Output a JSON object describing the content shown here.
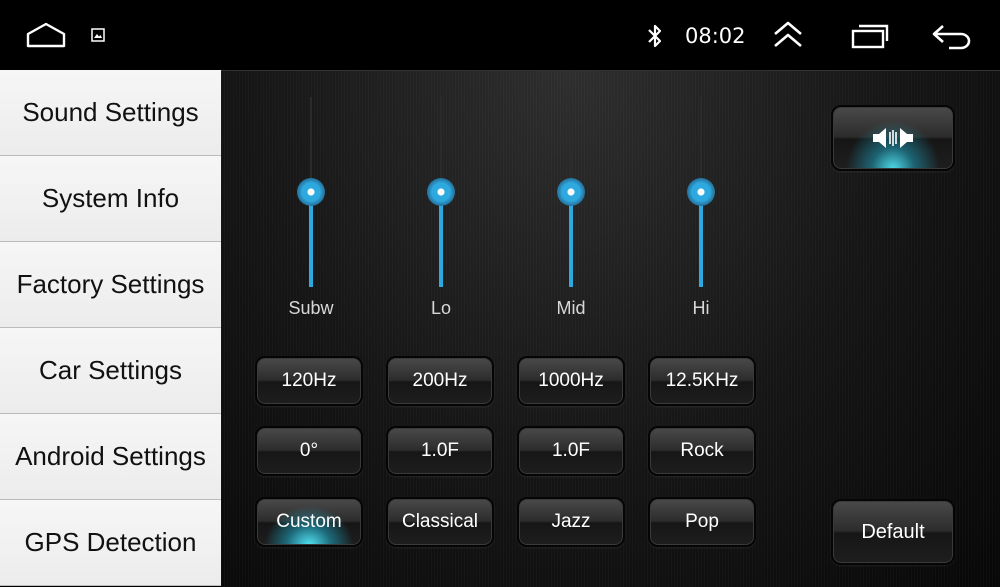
{
  "status_bar": {
    "time": "08:02",
    "icons": [
      "home-icon",
      "gallery-icon",
      "bluetooth-icon",
      "expand-up-icon",
      "recent-apps-icon",
      "back-icon"
    ]
  },
  "sidebar": {
    "items": [
      {
        "label": "Sound Settings"
      },
      {
        "label": "System Info"
      },
      {
        "label": "Factory Settings"
      },
      {
        "label": "Car Settings"
      },
      {
        "label": "Android Settings"
      },
      {
        "label": "GPS Detection"
      }
    ]
  },
  "equalizer": {
    "accent_color": "#2ea9df",
    "sliders": [
      {
        "label": "Subw",
        "level": 0.5
      },
      {
        "label": "Lo",
        "level": 0.5
      },
      {
        "label": "Mid",
        "level": 0.5
      },
      {
        "label": "Hi",
        "level": 0.5
      }
    ],
    "frequency_buttons": [
      "120Hz",
      "200Hz",
      "1000Hz",
      "12.5KHz"
    ],
    "setting_buttons": [
      "0°",
      "1.0F",
      "1.0F",
      "Rock"
    ],
    "preset_buttons": [
      "Custom",
      "Classical",
      "Jazz",
      "Pop"
    ],
    "active_preset": "Custom",
    "balance_button_icon": "speaker-balance-icon",
    "default_button": "Default"
  }
}
